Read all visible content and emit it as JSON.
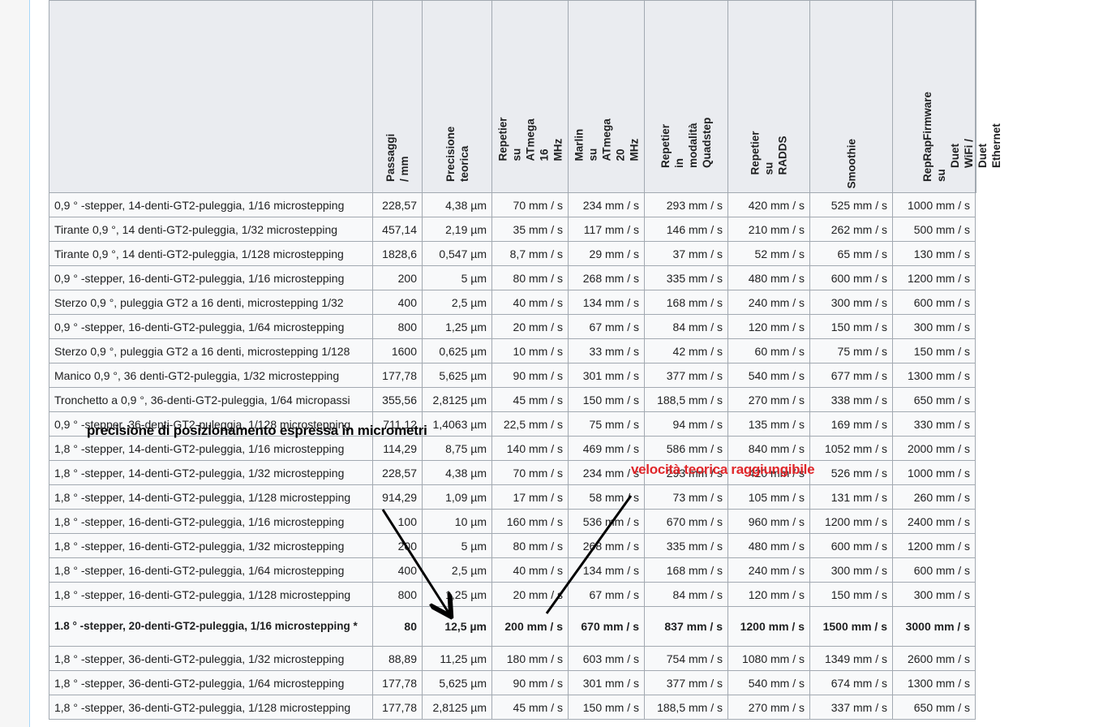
{
  "table": {
    "headers": [
      "",
      "Passaggi\n/ mm",
      "Precisione\nteorica",
      "Repetier\nsu\nATmega\n16\nMHz",
      "Marlin\nsu\nATmega\n20\nMHz",
      "Repetier\nin\nmodalità\nQuadstep",
      "Repetier\nsu\nRADDS",
      "Smoothie",
      "RepRapFirmware\nsu",
      "Duet\nWiFi /\nDuet\nEthernet"
    ],
    "rows": [
      [
        "0,9 ° -stepper, 14-denti-GT2-puleggia, 1/16 microstepping",
        "228,57",
        "4,38 µm",
        "70 mm / s",
        "234 mm / s",
        "293 mm / s",
        "420 mm / s",
        "525 mm / s",
        "1000 mm / s"
      ],
      [
        "Tirante 0,9 °, 14 denti-GT2-puleggia, 1/32 microstepping",
        "457,14",
        "2,19 µm",
        "35 mm / s",
        "117 mm / s",
        "146 mm / s",
        "210 mm / s",
        "262 mm / s",
        "500 mm / s"
      ],
      [
        "Tirante 0,9 °, 14 denti-GT2-puleggia, 1/128 microstepping",
        "1828,6",
        "0,547 µm",
        "8,7 mm / s",
        "29 mm / s",
        "37 mm / s",
        "52 mm / s",
        "65 mm / s",
        "130 mm / s"
      ],
      [
        "0,9 ° -stepper, 16-denti-GT2-puleggia, 1/16 microstepping",
        "200",
        "5 µm",
        "80 mm / s",
        "268 mm / s",
        "335 mm / s",
        "480 mm / s",
        "600 mm / s",
        "1200 mm / s"
      ],
      [
        "Sterzo 0,9 °, puleggia GT2 a 16 denti, microstepping 1/32",
        "400",
        "2,5 µm",
        "40 mm / s",
        "134 mm / s",
        "168 mm / s",
        "240 mm / s",
        "300 mm / s",
        "600 mm / s"
      ],
      [
        "0,9 ° -stepper, 16-denti-GT2-puleggia, 1/64 microstepping",
        "800",
        "1,25 µm",
        "20 mm / s",
        "67 mm / s",
        "84 mm / s",
        "120 mm / s",
        "150 mm / s",
        "300 mm / s"
      ],
      [
        "Sterzo 0,9 °, puleggia GT2 a 16 denti, microstepping 1/128",
        "1600",
        "0,625 µm",
        "10 mm / s",
        "33 mm / s",
        "42 mm / s",
        "60 mm / s",
        "75 mm / s",
        "150 mm / s"
      ],
      [
        "Manico 0,9 °, 36 denti-GT2-puleggia, 1/32 microstepping",
        "177,78",
        "5,625 µm",
        "90 mm / s",
        "301 mm / s",
        "377 mm / s",
        "540 mm / s",
        "677 mm / s",
        "1300 mm / s"
      ],
      [
        "Tronchetto a 0,9 °, 36-denti-GT2-puleggia, 1/64 micropassi",
        "355,56",
        "2,8125 µm",
        "45 mm / s",
        "150 mm / s",
        "188,5 mm / s",
        "270 mm / s",
        "338 mm / s",
        "650 mm / s"
      ],
      [
        "0,9 ° -stepper, 36-denti-GT2-puleggia, 1/128 microstepping",
        "711,12",
        "1,4063 µm",
        "22,5 mm / s",
        "75 mm / s",
        "94 mm / s",
        "135 mm / s",
        "169 mm / s",
        "330 mm / s"
      ],
      [
        "1,8 ° -stepper, 14-denti-GT2-puleggia, 1/16 microstepping",
        "114,29",
        "8,75 µm",
        "140 mm / s",
        "469 mm / s",
        "586 mm / s",
        "840 mm / s",
        "1052 mm / s",
        "2000 mm / s"
      ],
      [
        "1,8 ° -stepper, 14-denti-GT2-puleggia, 1/32 microstepping",
        "228,57",
        "4,38 µm",
        "70 mm / s",
        "234 mm / s",
        "293 mm / s",
        "420 mm / s",
        "526 mm / s",
        "1000 mm / s"
      ],
      [
        "1,8 ° -stepper, 14-denti-GT2-puleggia, 1/128 microstepping",
        "914,29",
        "1,09 µm",
        "17 mm / s",
        "58 mm / s",
        "73 mm / s",
        "105 mm / s",
        "131 mm / s",
        "260 mm / s"
      ],
      [
        "1,8 ° -stepper, 16-denti-GT2-puleggia, 1/16 microstepping",
        "100",
        "10 µm",
        "160 mm / s",
        "536 mm / s",
        "670 mm / s",
        "960 mm / s",
        "1200 mm / s",
        "2400 mm / s"
      ],
      [
        "1,8 ° -stepper, 16-denti-GT2-puleggia, 1/32 microstepping",
        "200",
        "5 µm",
        "80 mm / s",
        "268 mm / s",
        "335 mm / s",
        "480 mm / s",
        "600 mm / s",
        "1200 mm / s"
      ],
      [
        "1,8 ° -stepper, 16-denti-GT2-puleggia, 1/64 microstepping",
        "400",
        "2,5 µm",
        "40 mm / s",
        "134 mm / s",
        "168 mm / s",
        "240 mm / s",
        "300 mm / s",
        "600 mm / s"
      ],
      [
        "1,8 ° -stepper, 16-denti-GT2-puleggia, 1/128 microstepping",
        "800",
        "1,25 µm",
        "20 mm / s",
        "67 mm / s",
        "84 mm / s",
        "120 mm / s",
        "150 mm / s",
        "300 mm / s"
      ],
      [
        "1.8 ° -stepper, 20-denti-GT2-puleggia, 1/16 microstepping *",
        "80",
        "12,5 µm",
        "200 mm / s",
        "670 mm / s",
        "837 mm / s",
        "1200 mm / s",
        "1500 mm / s",
        "3000 mm / s"
      ],
      [
        "1,8 ° -stepper, 36-denti-GT2-puleggia, 1/32 microstepping",
        "88,89",
        "11,25 µm",
        "180 mm / s",
        "603 mm / s",
        "754 mm / s",
        "1080 mm / s",
        "1349 mm / s",
        "2600 mm / s"
      ],
      [
        "1,8 ° -stepper, 36-denti-GT2-puleggia, 1/64 microstepping",
        "177,78",
        "5,625 µm",
        "90 mm / s",
        "301 mm / s",
        "377 mm / s",
        "540 mm / s",
        "674 mm / s",
        "1300 mm / s"
      ],
      [
        "1,8 ° -stepper, 36-denti-GT2-puleggia, 1/128 microstepping",
        "177,78",
        "2,8125 µm",
        "45 mm / s",
        "150 mm / s",
        "188,5 mm / s",
        "270 mm / s",
        "337 mm / s",
        "650 mm / s"
      ]
    ],
    "bold_row_index": 17
  },
  "annotations": {
    "precision_note": "precisione di posizionamento espressa in micrometri",
    "speed_note": "velocità teorica raggiungibile",
    "precision_color": "#000000",
    "speed_color": "#e0262a"
  }
}
